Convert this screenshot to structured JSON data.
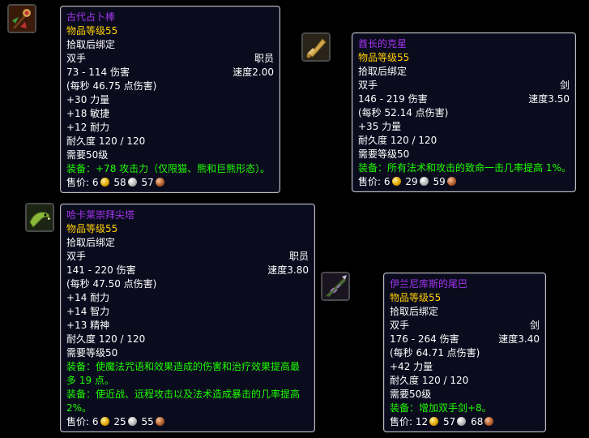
{
  "items": [
    {
      "name": "古代占卜棒",
      "item_level": "物品等级55",
      "binding": "拾取后绑定",
      "slot": "双手",
      "type": "职员",
      "damage": "73 - 114 伤害",
      "speed": "速度2.00",
      "dps": "(每秒 46.75 点伤害)",
      "stats": [
        "+30 力量",
        "+18 敏捷",
        "+12 耐力"
      ],
      "durability": "耐久度 120 / 120",
      "requirement": "需要50级",
      "equip": [
        "装备：+78 攻击力（仅限猫、熊和巨熊形态）。"
      ],
      "sell_label": "售价:",
      "price": {
        "gold": "6",
        "silver": "58",
        "copper": "57"
      },
      "icon": "staff-icon"
    },
    {
      "name": "酋长的克星",
      "item_level": "物品等级55",
      "binding": "拾取后绑定",
      "slot": "双手",
      "type": "剑",
      "damage": "146 - 219 伤害",
      "speed": "速度3.50",
      "dps": "(每秒 52.14 点伤害)",
      "stats": [
        "+35 力量"
      ],
      "durability": "耐久度 120 / 120",
      "requirement": "需要等级50",
      "equip": [
        "装备：所有法术和攻击的致命一击几率提高 1%。"
      ],
      "sell_label": "售价:",
      "price": {
        "gold": "6",
        "silver": "29",
        "copper": "59"
      },
      "icon": "sword-icon"
    },
    {
      "name": "哈卡莱崇拜尖塔",
      "item_level": "物品等级55",
      "binding": "拾取后绑定",
      "slot": "双手",
      "type": "职员",
      "damage": "141 - 220 伤害",
      "speed": "速度3.80",
      "dps": "(每秒 47.50 点伤害)",
      "stats": [
        "+14 耐力",
        "+14 智力",
        "+13 精神"
      ],
      "durability": "耐久度 120 / 120",
      "requirement": "需要等级50",
      "equip": [
        "装备：使魔法咒语和效果造成的伤害和治疗效果提高最多 19 点。",
        "装备：使近战、远程攻击以及法术造成暴击的几率提高 2%。"
      ],
      "sell_label": "售价:",
      "price": {
        "gold": "6",
        "silver": "25",
        "copper": "55"
      },
      "icon": "serpent-staff-icon"
    },
    {
      "name": "伊兰尼库斯的尾巴",
      "item_level": "物品等级55",
      "binding": "拾取后绑定",
      "slot": "双手",
      "type": "剑",
      "damage": "176 - 264 伤害",
      "speed": "速度3.40",
      "dps": "(每秒 64.71 点伤害)",
      "stats": [
        "+42 力量"
      ],
      "durability": "耐久度 120 / 120",
      "requirement": "需要50级",
      "equip": [
        "装备：增加双手剑+8。"
      ],
      "sell_label": "售价:",
      "price": {
        "gold": "12",
        "silver": "57",
        "copper": "68"
      },
      "icon": "tail-blade-icon"
    }
  ],
  "colors": {
    "epic": "#a335ee",
    "item_level": "#ffd100",
    "equip": "#1eff00",
    "background": "#0b0b1e"
  }
}
